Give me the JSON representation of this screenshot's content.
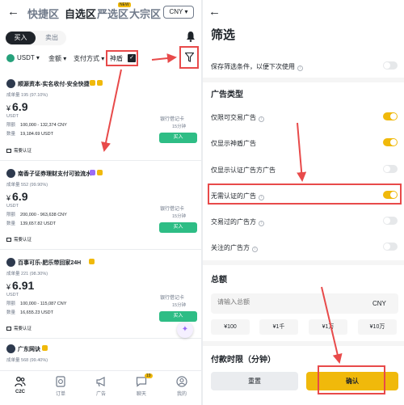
{
  "colors": {
    "brand": "#f0b90b",
    "buy": "#2ebd85",
    "annotation": "#e84a4a",
    "text": "#1e2329",
    "muted": "#707a8a"
  },
  "left": {
    "back_icon": "←",
    "tabs": [
      "快捷区",
      "自选区",
      "严选区",
      "大宗区"
    ],
    "new_badge": "NEW",
    "currency": "CNY ▾",
    "buy_tab": "买入",
    "sell_tab": "卖出",
    "filters": {
      "coin": "USDT ▾",
      "amount": "金额 ▾",
      "payment": "支付方式 ▾",
      "shield": "神盾"
    },
    "ads": [
      {
        "name": "顺源资本-实名收付-安全快捷",
        "stats": "成单量 195 (97.10%)",
        "price": "6.9",
        "unit": "USDT",
        "limit_label": "限额",
        "limit": "100,000 - 132,374 CNY",
        "qty_label": "数量",
        "qty": "19,184.69 USDT",
        "pay": "银行借记卡",
        "time": "15分钟",
        "buy": "买入",
        "verify": "需要认证"
      },
      {
        "name": "南香子证券理财支付可验流水",
        "stats": "成单量 552 (99.90%)",
        "price": "6.9",
        "unit": "USDT",
        "limit_label": "限额",
        "limit": "200,000 - 963,638 CNY",
        "qty_label": "数量",
        "qty": "139,657.82 USDT",
        "pay": "银行借记卡",
        "time": "15分钟",
        "buy": "买入",
        "verify": "需要认证"
      },
      {
        "name": "百事可乐-肥乐带回家24H",
        "stats": "成单量 221 (98.30%)",
        "price": "6.91",
        "unit": "USDT",
        "limit_label": "限额",
        "limit": "100,000 - 115,087 CNY",
        "qty_label": "数量",
        "qty": "16,655.23 USDT",
        "pay": "银行借记卡",
        "time": "15分钟",
        "buy": "买入",
        "verify": "需要认证"
      },
      {
        "name": "广东网诀",
        "stats": "成单量 568 (99.40%)"
      }
    ],
    "fab": "✦",
    "nav": [
      {
        "label": "C2C",
        "icon": "people-icon"
      },
      {
        "label": "订单",
        "icon": "order-icon"
      },
      {
        "label": "广告",
        "icon": "megaphone-icon"
      },
      {
        "label": "聊天",
        "icon": "chat-icon",
        "badge": "19"
      },
      {
        "label": "我的",
        "icon": "profile-icon"
      }
    ]
  },
  "right": {
    "back_icon": "←",
    "title": "筛选",
    "save_filter": {
      "label": "保存筛选条件，以便下次使用",
      "on": false
    },
    "ad_type_header": "广告类型",
    "options": [
      {
        "label": "仅限可交易广告",
        "on": true,
        "info": true
      },
      {
        "label": "仅显示神盾广告",
        "on": true,
        "info": false
      },
      {
        "label": "仅显示认证广告方广告",
        "on": false,
        "info": false
      },
      {
        "label": "无需认证的广告",
        "on": true,
        "info": true
      },
      {
        "label": "交易过的广告方",
        "on": false,
        "info": true
      },
      {
        "label": "关注的广告方",
        "on": false,
        "info": true
      }
    ],
    "amount_header": "总额",
    "amount_placeholder": "请输入总额",
    "amount_currency": "CNY",
    "quick_amounts": [
      "¥100",
      "¥1千",
      "¥1万",
      "¥10万"
    ],
    "payment_time_header": "付款时限（分钟）",
    "reset": "重置",
    "confirm": "确认"
  }
}
